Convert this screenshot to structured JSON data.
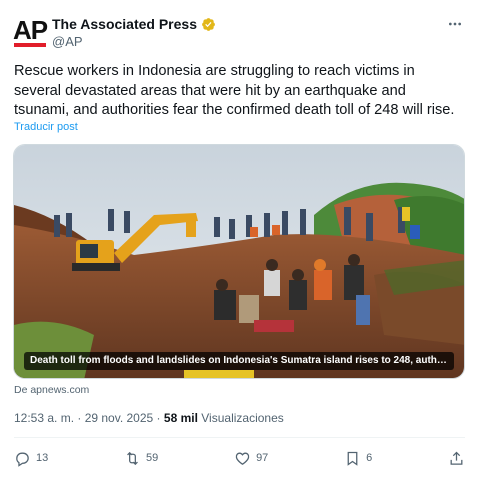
{
  "account": {
    "display_name": "The Associated Press",
    "handle": "@AP",
    "logo_text": "AP",
    "verified_color": "#e2b719"
  },
  "post": {
    "text": "Rescue workers in Indonesia are struggling to reach victims in several devastated areas that were hit by an earthquake and tsunami, and authorities fear the confirmed death toll of 248 will rise.",
    "translate_link": "Traducir post",
    "card_caption": "Death toll from floods and landslides on Indonesia's Sumatra island rises to 248, auth…",
    "source": "De apnews.com",
    "timestamp": "12:53 a. m. · 29 nov. 2025",
    "views_count": "58 mil",
    "views_label": "Visualizaciones"
  },
  "actions": {
    "replies": "13",
    "reposts": "59",
    "likes": "97",
    "bookmarks": "6"
  },
  "icons": [
    "verified-badge-icon",
    "more-icon",
    "reply-icon",
    "repost-icon",
    "like-icon",
    "bookmark-icon",
    "share-icon"
  ],
  "colors": {
    "link": "#1d9bf0",
    "muted": "#536471",
    "text": "#0f1419",
    "brand_red": "#e11d2a"
  }
}
